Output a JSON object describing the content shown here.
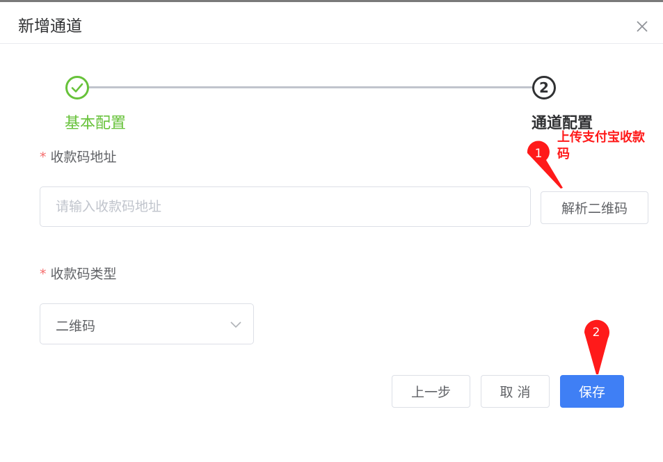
{
  "dialog": {
    "title": "新增通道",
    "close_icon": "close-icon"
  },
  "steps": [
    {
      "title": "基本配置",
      "status": "finished",
      "icon": "check-circle-icon",
      "color": "#67c23a"
    },
    {
      "title": "通道配置",
      "status": "active",
      "number": "2",
      "color": "#303133"
    }
  ],
  "form": {
    "field1": {
      "required_mark": "*",
      "label": "收款码地址",
      "value": "",
      "placeholder": "请输入收款码地址"
    },
    "parse_button": "解析二维码",
    "field2": {
      "required_mark": "*",
      "label": "收款码类型",
      "selected": "二维码",
      "icon": "chevron-down-icon"
    }
  },
  "footer": {
    "prev_label": "上一步",
    "cancel_label": "取 消",
    "save_label": "保存"
  },
  "annotations": {
    "marker1_number": "1",
    "marker1_text": "上传支付宝收款码",
    "marker2_number": "2",
    "color": "#ff1a1a"
  },
  "colors": {
    "primary": "#3f7ff5",
    "success": "#67c23a",
    "required": "#f56c6c"
  }
}
